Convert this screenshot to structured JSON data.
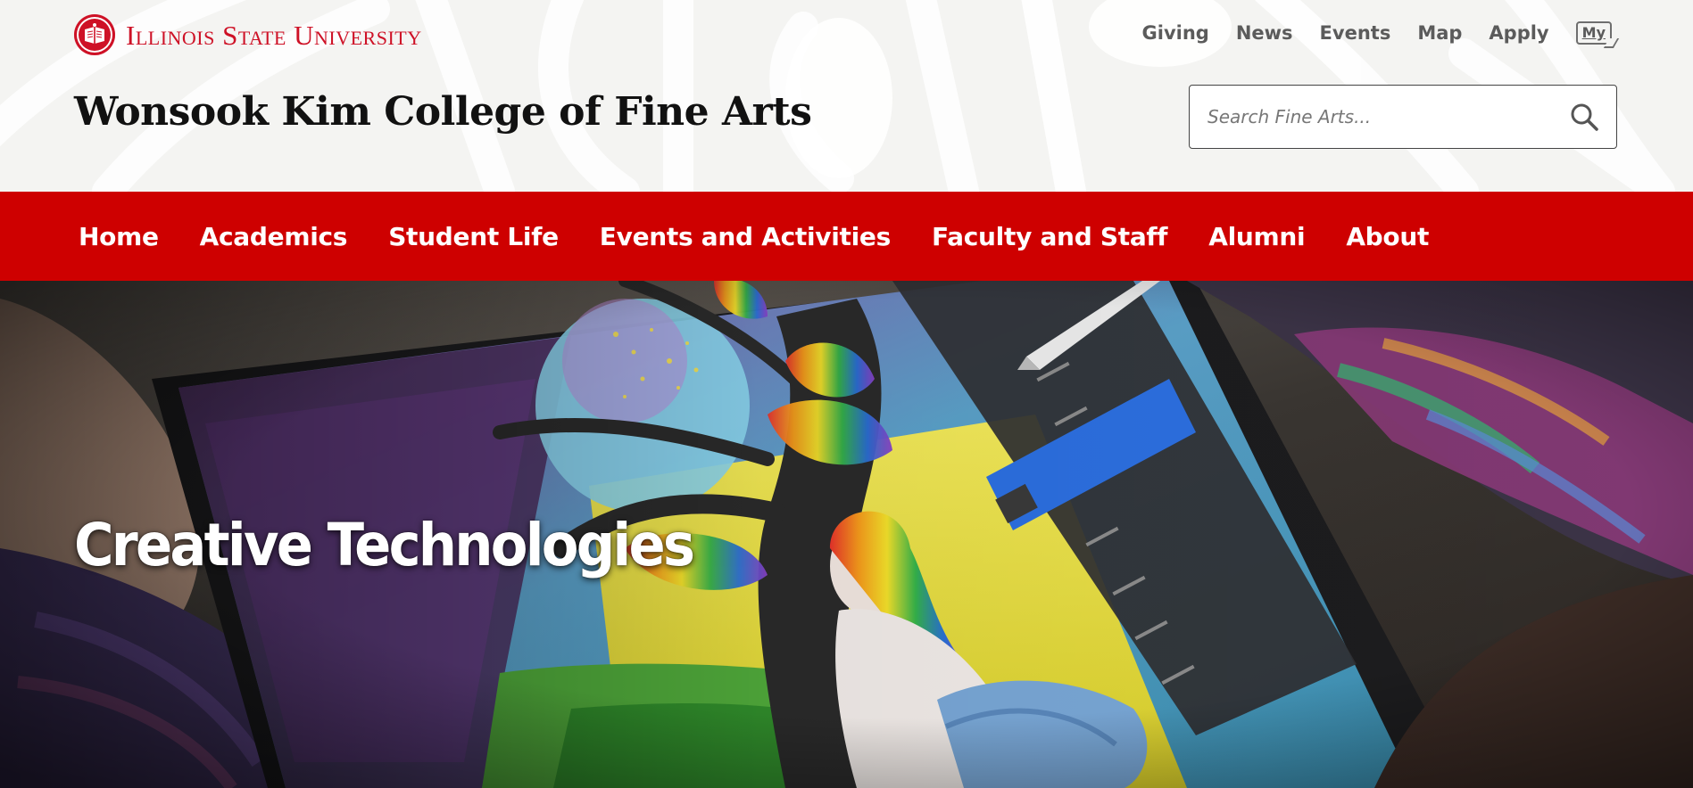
{
  "header": {
    "university_name": "Illinois State University",
    "college_title": "Wonsook Kim College of Fine Arts",
    "utility_links": [
      "Giving",
      "News",
      "Events",
      "Map",
      "Apply"
    ],
    "my_badge": "My"
  },
  "search": {
    "placeholder": "Search Fine Arts...",
    "value": ""
  },
  "nav": {
    "items": [
      "Home",
      "Academics",
      "Student Life",
      "Events and Activities",
      "Faculty and Staff",
      "Alumni",
      "About"
    ]
  },
  "hero": {
    "title": "Creative Technologies"
  },
  "colors": {
    "brand_red": "#ce1126",
    "nav_red": "#ce0000",
    "header_bg": "#f4f4f2",
    "utility_text": "#5b5b5b"
  },
  "icons": {
    "seal": "isu-seal-icon",
    "search": "search-icon",
    "my": "my-isu-icon"
  }
}
